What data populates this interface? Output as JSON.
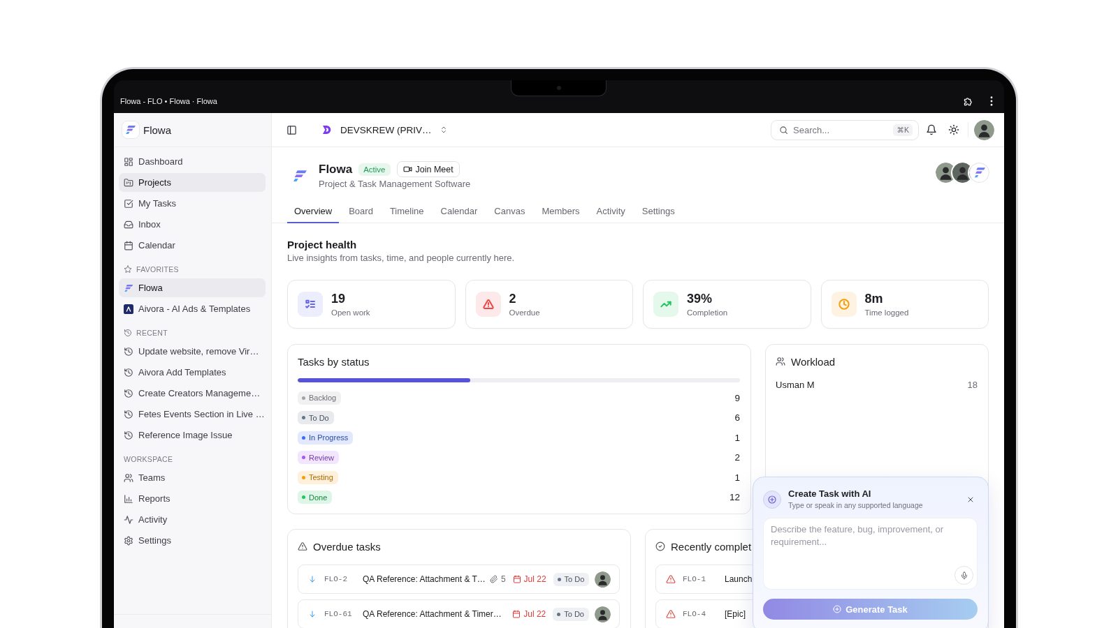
{
  "browser": {
    "title": "Flowa - FLO • Flowa · Flowa"
  },
  "sidebar": {
    "brand": "Flowa",
    "nav": [
      {
        "label": "Dashboard",
        "selected": false
      },
      {
        "label": "Projects",
        "selected": true
      },
      {
        "label": "My Tasks",
        "selected": false
      },
      {
        "label": "Inbox",
        "selected": false
      },
      {
        "label": "Calendar",
        "selected": false
      }
    ],
    "favorites": {
      "heading": "FAVORITES",
      "items": [
        {
          "label": "Flowa",
          "selected": true
        },
        {
          "label": "Aivora - AI Ads & Templates",
          "selected": false
        }
      ]
    },
    "recent": {
      "heading": "RECENT",
      "items": [
        {
          "label": "Update website, remove Vir…",
          "selected": false
        },
        {
          "label": "Aivora Add Templates",
          "selected": false
        },
        {
          "label": "Create Creators Manageme…",
          "selected": false
        },
        {
          "label": "Fetes Events Section in Live …",
          "selected": false
        },
        {
          "label": "Reference Image Issue",
          "selected": false
        }
      ]
    },
    "workspace": {
      "heading": "WORKSPACE",
      "items": [
        {
          "label": "Teams",
          "selected": false
        },
        {
          "label": "Reports",
          "selected": false
        },
        {
          "label": "Activity",
          "selected": false
        },
        {
          "label": "Settings",
          "selected": false
        }
      ]
    }
  },
  "topbar": {
    "workspace": "DEVSKREW (PRIV…",
    "search": {
      "placeholder": "Search...",
      "shortcut": "⌘K"
    }
  },
  "project": {
    "name": "Flowa",
    "status": "Active",
    "meet_button": "Join Meet",
    "description": "Project & Task Management Software"
  },
  "tabs": [
    {
      "label": "Overview",
      "selected": true
    },
    {
      "label": "Board",
      "selected": false
    },
    {
      "label": "Timeline",
      "selected": false
    },
    {
      "label": "Calendar",
      "selected": false
    },
    {
      "label": "Canvas",
      "selected": false
    },
    {
      "label": "Members",
      "selected": false
    },
    {
      "label": "Activity",
      "selected": false
    },
    {
      "label": "Settings",
      "selected": false
    }
  ],
  "health": {
    "title": "Project health",
    "subtitle": "Live insights from tasks, time, and people currently here.",
    "stats": [
      {
        "value": "19",
        "label": "Open work",
        "color": "#6366f1"
      },
      {
        "value": "2",
        "label": "Overdue",
        "color": "#ef4444"
      },
      {
        "value": "39%",
        "label": "Completion",
        "color": "#22c55e"
      },
      {
        "value": "8m",
        "label": "Time logged",
        "color": "#f59e0b"
      }
    ]
  },
  "tasks_by_status": {
    "title": "Tasks by status",
    "progress": {
      "level": 0.39
    },
    "statuses": [
      {
        "label": "Backlog",
        "count": "9",
        "color": "#a1a1aa"
      },
      {
        "label": "To Do",
        "count": "6",
        "color": "#64748b"
      },
      {
        "label": "In Progress",
        "count": "1",
        "color": "#3b6ef5"
      },
      {
        "label": "Review",
        "count": "2",
        "color": "#a855f7"
      },
      {
        "label": "Testing",
        "count": "1",
        "color": "#f59e0b"
      },
      {
        "label": "Done",
        "count": "12",
        "color": "#22c55e"
      }
    ]
  },
  "workload": {
    "title": "Workload",
    "rows": [
      {
        "name": "Usman M",
        "count": "18"
      }
    ]
  },
  "overdue": {
    "title": "Overdue tasks",
    "tasks": [
      {
        "key": "FLO-2",
        "title": "QA Reference: Attachment & T…",
        "attachments": "5",
        "due": "Jul 22",
        "status": "To Do"
      },
      {
        "key": "FLO-61",
        "title": "QA Reference: Attachment & Timer…",
        "due": "Jul 22",
        "status": "To Do"
      }
    ]
  },
  "recently_completed": {
    "title": "Recently complet",
    "tasks": [
      {
        "key": "FLO-1",
        "title": "Launch"
      },
      {
        "key": "FLO-4",
        "title": "[Epic]"
      }
    ]
  },
  "ai_panel": {
    "title": "Create Task with AI",
    "subtitle": "Type or speak in any supported language",
    "placeholder": "Describe the feature, bug, improvement, or requirement...",
    "button": "Generate Task"
  }
}
